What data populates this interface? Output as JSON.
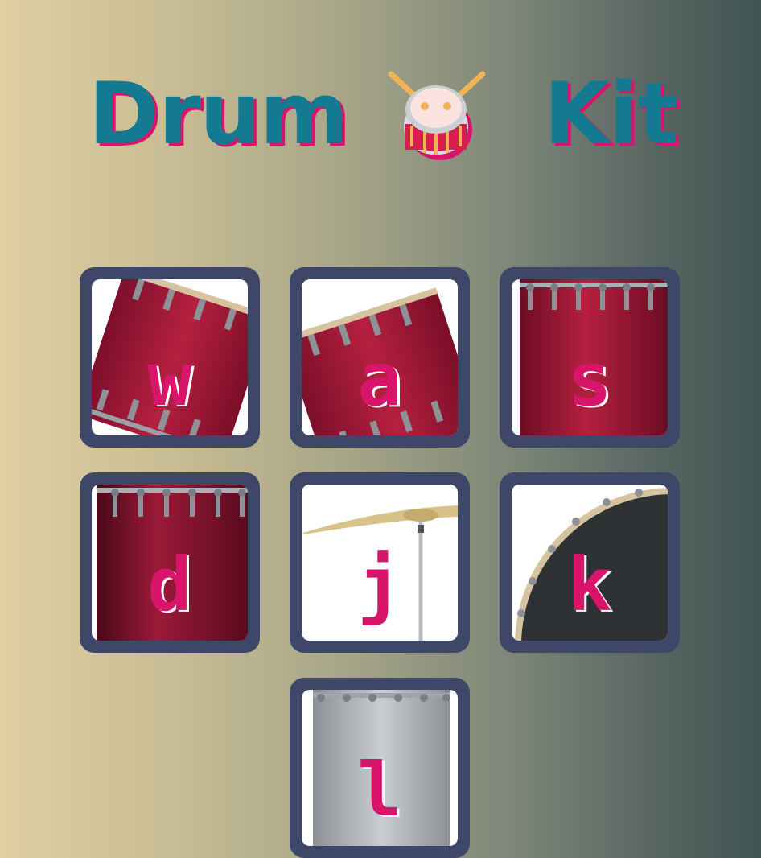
{
  "header": {
    "title_left": "Drum",
    "title_right": "Kit",
    "title_icon": "drum-icon"
  },
  "pads": [
    {
      "key": "w",
      "image": "tom-drum-tilted-left"
    },
    {
      "key": "a",
      "image": "tom-drum-tilted-right"
    },
    {
      "key": "s",
      "image": "snare-drum"
    },
    {
      "key": "d",
      "image": "floor-tom-drum"
    },
    {
      "key": "j",
      "image": "crash-cymbal"
    },
    {
      "key": "k",
      "image": "kick-drum"
    },
    {
      "key": "l",
      "image": "silver-drum"
    }
  ],
  "colors": {
    "title": "#137a92",
    "title_shadow": "#d8156a",
    "pad_border": "#3f4769",
    "key_letter": "#d8156a",
    "drum_red": "#a3183a"
  }
}
